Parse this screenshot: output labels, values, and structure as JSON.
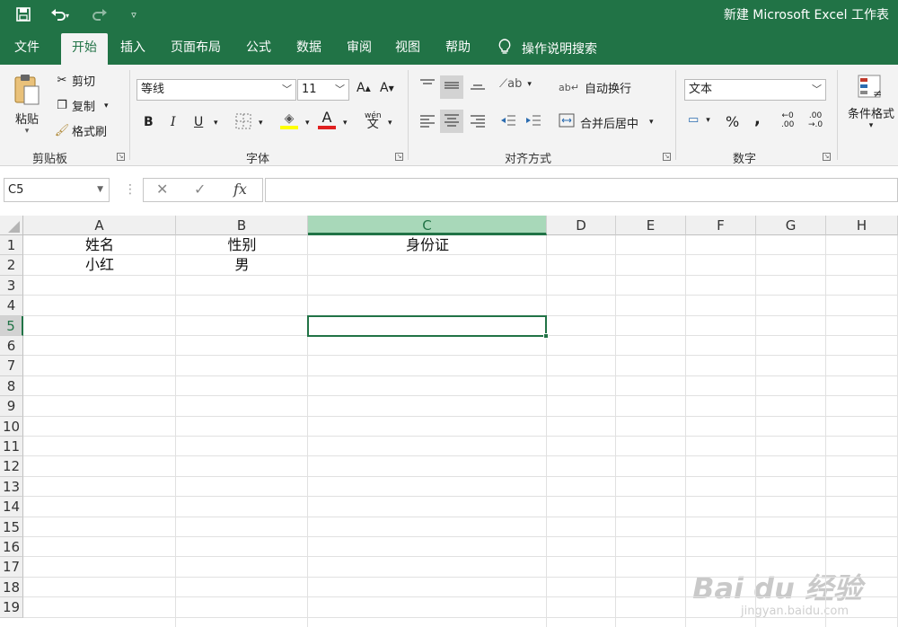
{
  "window": {
    "title": "新建 Microsoft Excel 工作表"
  },
  "quick_access": {
    "save_icon": "save-icon",
    "undo_icon": "undo-icon",
    "redo_icon": "redo-icon",
    "customize_icon": "customize-icon"
  },
  "tabs": [
    {
      "label": "文件"
    },
    {
      "label": "开始",
      "active": true
    },
    {
      "label": "插入"
    },
    {
      "label": "页面布局"
    },
    {
      "label": "公式"
    },
    {
      "label": "数据"
    },
    {
      "label": "审阅"
    },
    {
      "label": "视图"
    },
    {
      "label": "帮助"
    }
  ],
  "search": {
    "label": "操作说明搜索"
  },
  "ribbon": {
    "clipboard": {
      "paste": "粘贴",
      "cut": "剪切",
      "copy": "复制",
      "format_painter": "格式刷",
      "group": "剪贴板"
    },
    "font": {
      "name": "等线",
      "size": "11",
      "bold": "B",
      "italic": "I",
      "underline": "U",
      "group": "字体",
      "grow": "A",
      "shrink": "A",
      "font_color_letter": "A",
      "phonetic": "wén",
      "colors": {
        "highlight": "#ffff00",
        "font": "#e02020"
      }
    },
    "alignment": {
      "wrap": "自动换行",
      "merge": "合并后居中",
      "group": "对齐方式"
    },
    "number": {
      "format": "文本",
      "percent": "%",
      "comma": ",",
      "inc_decimal_top": "←0",
      "inc_decimal_bottom": ".00",
      "dec_decimal_top": ".00",
      "dec_decimal_bottom": "→.0",
      "group": "数字"
    },
    "styles": {
      "conditional": "条件格式"
    }
  },
  "formula_bar": {
    "name_box": "C5",
    "fx": "fx",
    "value": ""
  },
  "columns": [
    "A",
    "B",
    "C",
    "D",
    "E",
    "F",
    "G",
    "H"
  ],
  "rows": [
    "1",
    "2",
    "3",
    "4",
    "5",
    "6",
    "7",
    "8",
    "9",
    "10",
    "11",
    "12",
    "13",
    "14",
    "15",
    "16",
    "17",
    "18",
    "19"
  ],
  "cells": {
    "A1": "姓名",
    "B1": "性别",
    "C1": "身份证",
    "A2": "小红",
    "B2": "男"
  },
  "selected_cell": "C5",
  "watermark": {
    "main": "Bai du 经验",
    "sub": "jingyan.baidu.com"
  }
}
